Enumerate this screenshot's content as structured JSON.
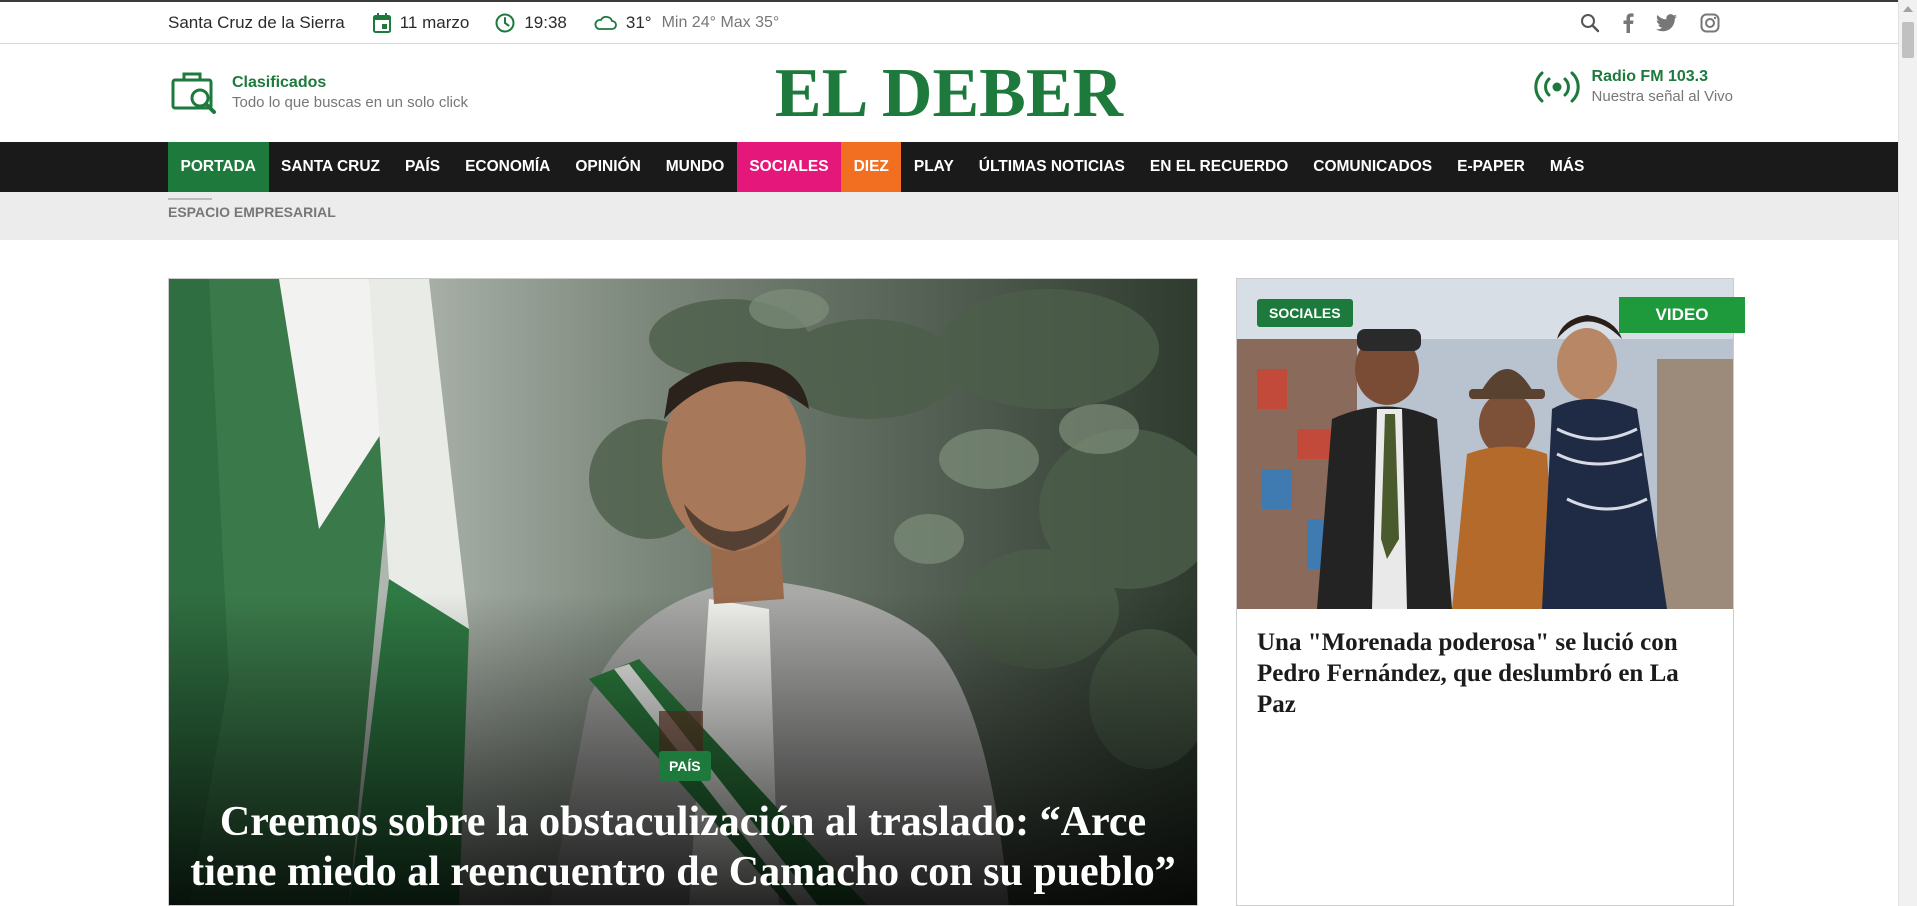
{
  "topbar": {
    "city": "Santa Cruz de la Sierra",
    "date": "11 marzo",
    "time": "19:38",
    "temp": "31°",
    "minmax": "Min 24° Max 35°",
    "icons": [
      "calendar-icon",
      "clock-icon",
      "cloud-icon",
      "search-icon",
      "facebook-icon",
      "twitter-icon",
      "instagram-icon"
    ]
  },
  "header": {
    "clasificados_title": "Clasificados",
    "clasificados_sub": "Todo lo que buscas en un solo click",
    "logo": "EL DEBER",
    "radio_title": "Radio FM 103.3",
    "radio_sub": "Nuestra señal al Vivo"
  },
  "nav": {
    "items": [
      "PORTADA",
      "SANTA CRUZ",
      "PAÍS",
      "ECONOMÍA",
      "OPINIÓN",
      "MUNDO",
      "SOCIALES",
      "DIEZ",
      "PLAY",
      "ÚLTIMAS NOTICIAS",
      "EN EL RECUERDO",
      "COMUNICADOS",
      "E-PAPER",
      "MÁS"
    ],
    "sub": "ESPACIO EMPRESARIAL"
  },
  "hero": {
    "section": "PAÍS",
    "headline": "Creemos sobre la obstaculización al traslado: “Arce tiene miedo al reencuentro de Camacho con su pueblo”"
  },
  "side": {
    "section": "SOCIALES",
    "video_label": "VIDEO",
    "headline": "Una \"Morenada poderosa\" se lució con Pedro Fernández, que deslumbró en La Paz"
  },
  "colors": {
    "brand_green": "#1e7a3c",
    "nav_bg": "#1a1a1a",
    "sociales_pink": "#e6177a",
    "diez_orange": "#f26f21"
  }
}
